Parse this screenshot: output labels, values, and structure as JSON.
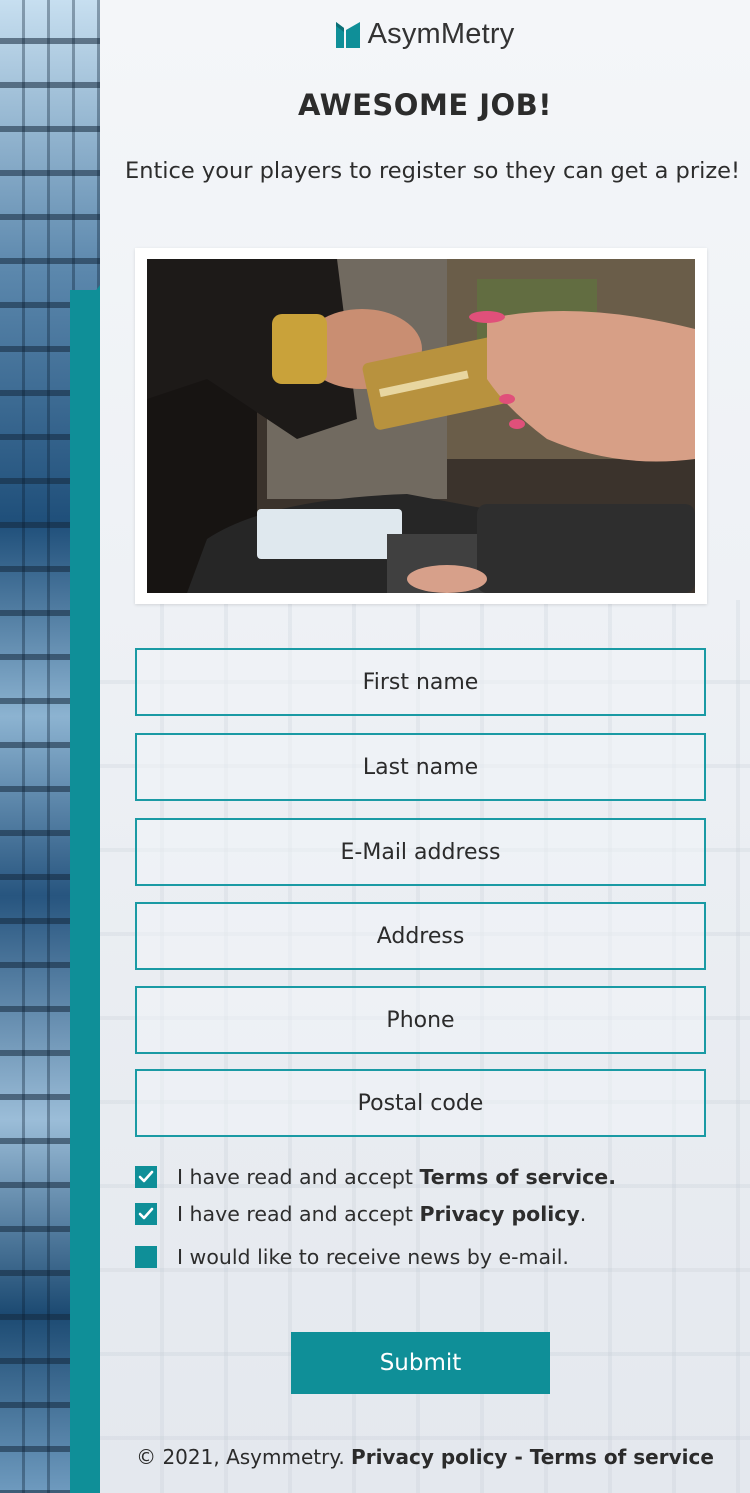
{
  "brand": {
    "name": "AsymMetry",
    "accent_color": "#0f8f98"
  },
  "hero": {
    "title": "AWESOME JOB!",
    "subtitle": "Entice your players to register so they can get a prize!"
  },
  "form": {
    "fields": [
      {
        "placeholder": "First name",
        "value": ""
      },
      {
        "placeholder": "Last name",
        "value": ""
      },
      {
        "placeholder": "E-Mail address",
        "value": ""
      },
      {
        "placeholder": "Address",
        "value": ""
      },
      {
        "placeholder": "Phone",
        "value": ""
      },
      {
        "placeholder": "Postal code",
        "value": ""
      }
    ],
    "checkboxes": [
      {
        "prefix": "I have read and accept ",
        "bold": "Terms of service.",
        "suffix": "",
        "checked": true
      },
      {
        "prefix": "I have read and accept ",
        "bold": "Privacy policy",
        "suffix": ".",
        "checked": true
      },
      {
        "prefix": "I would like to receive news by e-mail.",
        "bold": "",
        "suffix": "",
        "checked": false
      }
    ],
    "submit_label": "Submit"
  },
  "footer": {
    "copyright": "© 2021, Asymmetry. ",
    "privacy_link": "Privacy policy",
    "separator": " - ",
    "terms_link": "Terms of service"
  },
  "icons": {
    "logo": "asymmetry-logo-icon",
    "check": "checkmark-icon"
  }
}
